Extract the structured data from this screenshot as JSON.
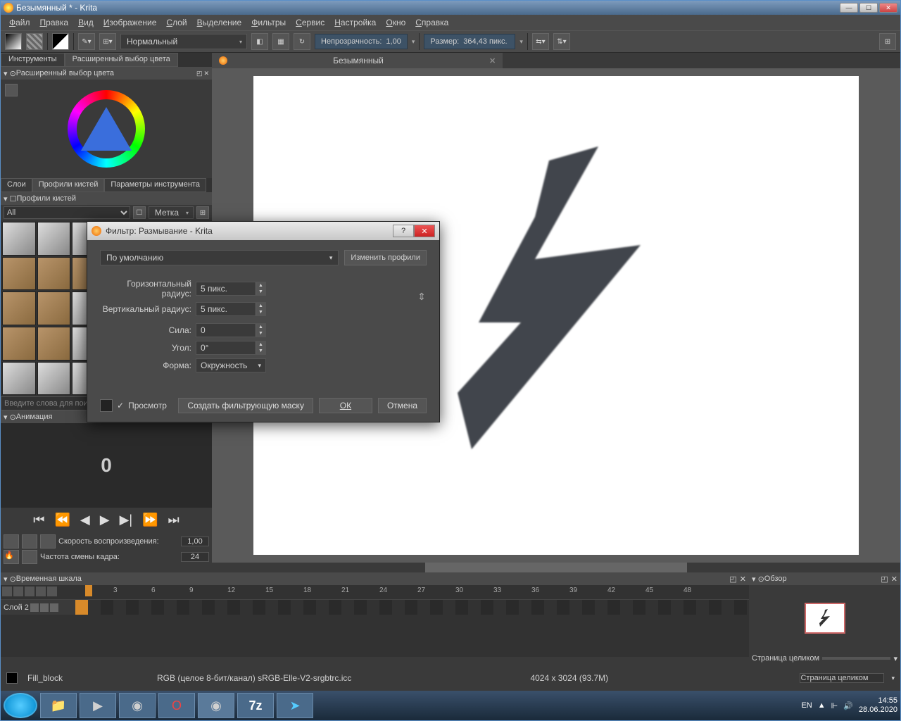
{
  "window": {
    "title": "Безымянный * - Krita"
  },
  "menu": [
    "Файл",
    "Правка",
    "Вид",
    "Изображение",
    "Слой",
    "Выделение",
    "Фильтры",
    "Сервис",
    "Настройка",
    "Окно",
    "Справка"
  ],
  "toolbar": {
    "blending": "Нормальный",
    "opacity_label": "Непрозрачность:",
    "opacity_value": "1,00",
    "size_label": "Размер:",
    "size_value": "364,43 пикс."
  },
  "left": {
    "tabs": [
      "Инструменты",
      "Расширенный выбор цвета"
    ],
    "color_header": "Расширенный выбор цвета",
    "brush_tabs": [
      "Слои",
      "Профили кистей",
      "Параметры инструмента"
    ],
    "brush_header": "Профили кистей",
    "brush_filter": "All",
    "brush_tag": "Метка",
    "brush_search_ph": "Введите слова для поиска",
    "anim_header": "Анимация",
    "anim_frame": "0",
    "anim_speed_label": "Скорость воспроизведения:",
    "anim_speed_value": "1,00",
    "anim_fps_label": "Частота смены кадра:",
    "anim_fps_value": "24"
  },
  "canvas": {
    "doc_title": "Безымянный"
  },
  "timeline": {
    "header": "Временная шкала",
    "layer": "Слой 2",
    "ticks": [
      "3",
      "6",
      "9",
      "12",
      "15",
      "18",
      "21",
      "24",
      "27",
      "30",
      "33",
      "36",
      "39",
      "42",
      "45",
      "48"
    ]
  },
  "overview": {
    "header": "Обзор",
    "zoom_label": "Страница целиком"
  },
  "status": {
    "brush_name": "Fill_block",
    "color_info": "RGB (целое 8-бит/канал)  sRGB-Elle-V2-srgbtrc.icc",
    "dims": "4024 x 3024 (93.7M)",
    "zoom": "Страница целиком"
  },
  "dialog": {
    "title": "Фильтр: Размывание - Krita",
    "profile": "По умолчанию",
    "edit_profiles": "Изменить профили",
    "hradius_lbl": "Горизонтальный радиус:",
    "hradius_val": "5 пикс.",
    "vradius_lbl": "Вертикальный радиус:",
    "vradius_val": "5 пикс.",
    "strength_lbl": "Сила:",
    "strength_val": "0",
    "angle_lbl": "Угол:",
    "angle_val": "0°",
    "shape_lbl": "Форма:",
    "shape_val": "Окружность",
    "preview": "Просмотр",
    "create_mask": "Создать фильтрующую маску",
    "ok": "ОК",
    "cancel": "Отмена"
  },
  "taskbar": {
    "lang": "EN",
    "time": "14:55",
    "date": "28.06.2020"
  }
}
